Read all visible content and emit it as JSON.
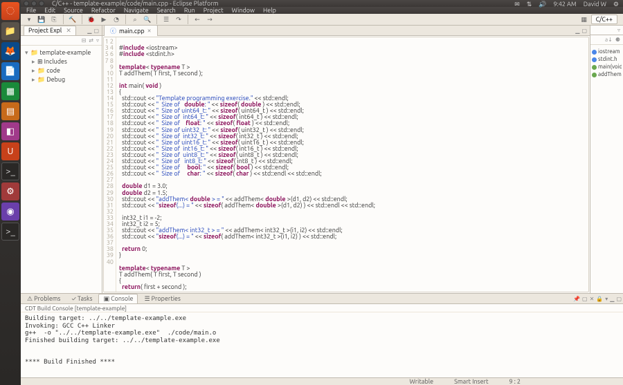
{
  "panel": {
    "time": "9:42 AM",
    "user": "David W",
    "icons": [
      "mail",
      "notify",
      "network",
      "sound"
    ]
  },
  "window": {
    "title": "C/C++ - template-example/code/main.cpp - Eclipse Platform"
  },
  "menu": [
    "File",
    "Edit",
    "Source",
    "Refactor",
    "Navigate",
    "Search",
    "Run",
    "Project",
    "Window",
    "Help"
  ],
  "perspective": "C/C++",
  "project_explorer": {
    "title": "Project Expl",
    "items": [
      {
        "label": "template-example",
        "expanded": true,
        "children": [
          {
            "label": "Includes"
          },
          {
            "label": "code"
          },
          {
            "label": "Debug"
          }
        ]
      }
    ]
  },
  "editor": {
    "tab": "main.cpp",
    "lines": [
      "",
      "#include <iostream>",
      "#include <stdint.h>",
      "",
      "template< typename T >",
      "T addThem( T first, T second );",
      "",
      "int main( void )",
      "{",
      "  std::cout << \"Template programming exercise.\" << std::endl;",
      "  std::cout << \"  Size of   double: \" << sizeof( double ) << std::endl;",
      "  std::cout << \"  Size of uint64_t: \" << sizeof( uint64_t ) << std::endl;",
      "  std::cout << \"  Size of  int64_t: \" << sizeof( int64_t ) << std::endl;",
      "  std::cout << \"  Size of    float: \" << sizeof( float ) << std::endl;",
      "  std::cout << \"  Size of uint32_t: \" << sizeof( uint32_t ) << std::endl;",
      "  std::cout << \"  Size of  int32_t: \" << sizeof( int32_t ) << std::endl;",
      "  std::cout << \"  Size of uint16_t: \" << sizeof( uint16_t ) << std::endl;",
      "  std::cout << \"  Size of  int16_t: \" << sizeof( int16_t ) << std::endl;",
      "  std::cout << \"  Size of  uint8_t: \" << sizeof( uint8_t ) << std::endl;",
      "  std::cout << \"  Size of   int8_t: \" << sizeof( int8_t ) << std::endl;",
      "  std::cout << \"  Size of     bool: \" << sizeof( bool ) << std::endl;",
      "  std::cout << \"  Size of     char: \" << sizeof( char ) << std::endl << std::endl;",
      "",
      "  double d1 = 3.0;",
      "  double d2 = 1.5;",
      "  std::cout << \"addThem< double > = \" << addThem< double >(d1, d2) << std::endl;",
      "  std::cout << \"sizeof(...) = \" << sizeof( addThem< double >(d1, d2) ) << std::endl << std::endl;",
      "",
      "  int32_t i1 = -2;",
      "  int32_t i2 = 5;",
      "  std::cout << \"addThem< int32_t > = \" << addThem< int32_t >(i1, i2) << std::endl;",
      "  std::cout << \"sizeof(...) = \" << sizeof( addThem< int32_t >(i1, i2) ) << std::endl;",
      "",
      "  return 0;",
      "}",
      "",
      "template< typename T >",
      "T addThem( T first, T second )",
      "{",
      "  return( first + second );"
    ]
  },
  "outline": {
    "items": [
      "iostream",
      "stdint.h",
      "main(void",
      "addThem"
    ]
  },
  "bottom_tabs": [
    "Problems",
    "Tasks",
    "Console",
    "Properties"
  ],
  "console": {
    "subtitle": "CDT Build Console [template-example]",
    "body": "Building target: ../../template-example.exe\nInvoking: GCC C++ Linker\ng++  -o \"../../template-example.exe\"  ./code/main.o\nFinished building target: ../../template-example.exe\n\n\n**** Build Finished ****"
  },
  "status": {
    "writable": "Writable",
    "insert": "Smart Insert",
    "pos": "9 : 2"
  }
}
